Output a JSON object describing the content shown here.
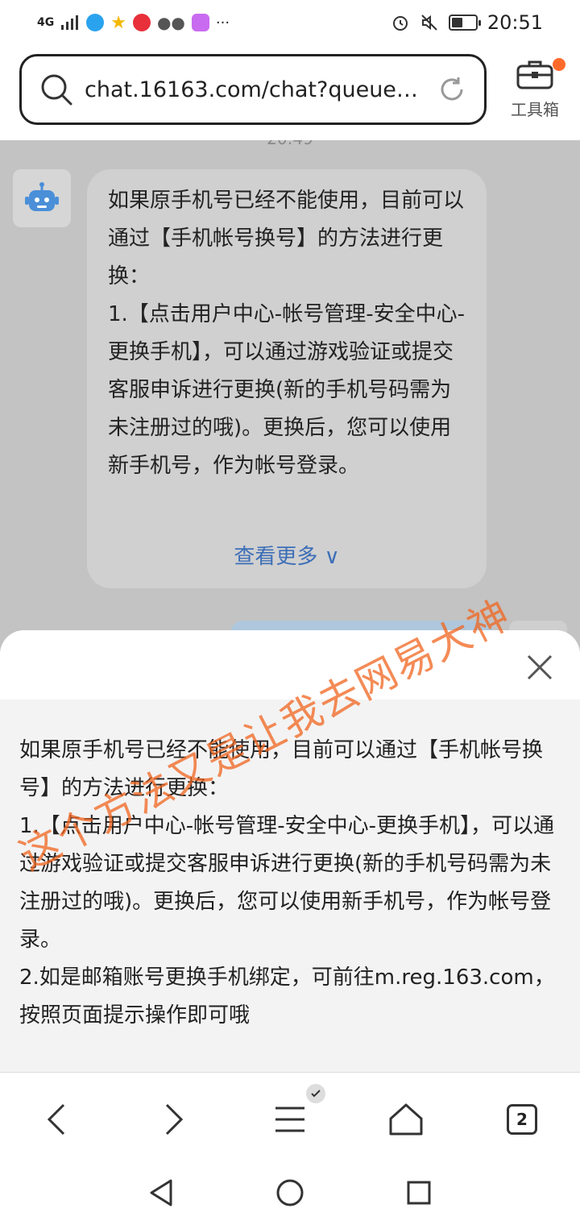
{
  "status_bar": {
    "signal": "4G",
    "time": "20:51",
    "more": "···",
    "colors": {
      "app1": "#2aa3ef",
      "app2": "#f5b800",
      "app3": "#e8303b",
      "app4": "#555555",
      "app5": "#c86bf0"
    }
  },
  "address_bar": {
    "url": "chat.16163.com/chat?queuena...",
    "toolbox_label": "工具箱"
  },
  "chat": {
    "timestamp": "20:49",
    "bot_message": "如果原手机号已经不能使用，目前可以通过【手机帐号换号】的方法进行更换：\n1.【点击用户中心-帐号管理-安全中心-更换手机】，可以通过游戏验证或提交客服申诉进行更换(新的手机号码需为未注册过的哦)。更换后，您可以使用新手机号，作为帐号登录。",
    "see_more": "查看更多 ∨"
  },
  "sheet": {
    "text": "如果原手机号已经不能使用，目前可以通过【手机帐号换号】的方法进行更换：\n1.【点击用户中心-帐号管理-安全中心-更换手机】，可以通过游戏验证或提交客服申诉进行更换(新的手机号码需为未注册过的哦)。更换后，您可以使用新手机号，作为帐号登录。\n2.如是邮箱账号更换手机绑定，可前往m.reg.163.com，按照页面提示操作即可哦"
  },
  "watermark": "这个方法又是让我去网易大神",
  "browser_nav": {
    "tab_count": "2"
  },
  "accent_colors": {
    "link": "#3d6fb8",
    "watermark": "#f0641e",
    "notification": "#ff6a2b"
  }
}
